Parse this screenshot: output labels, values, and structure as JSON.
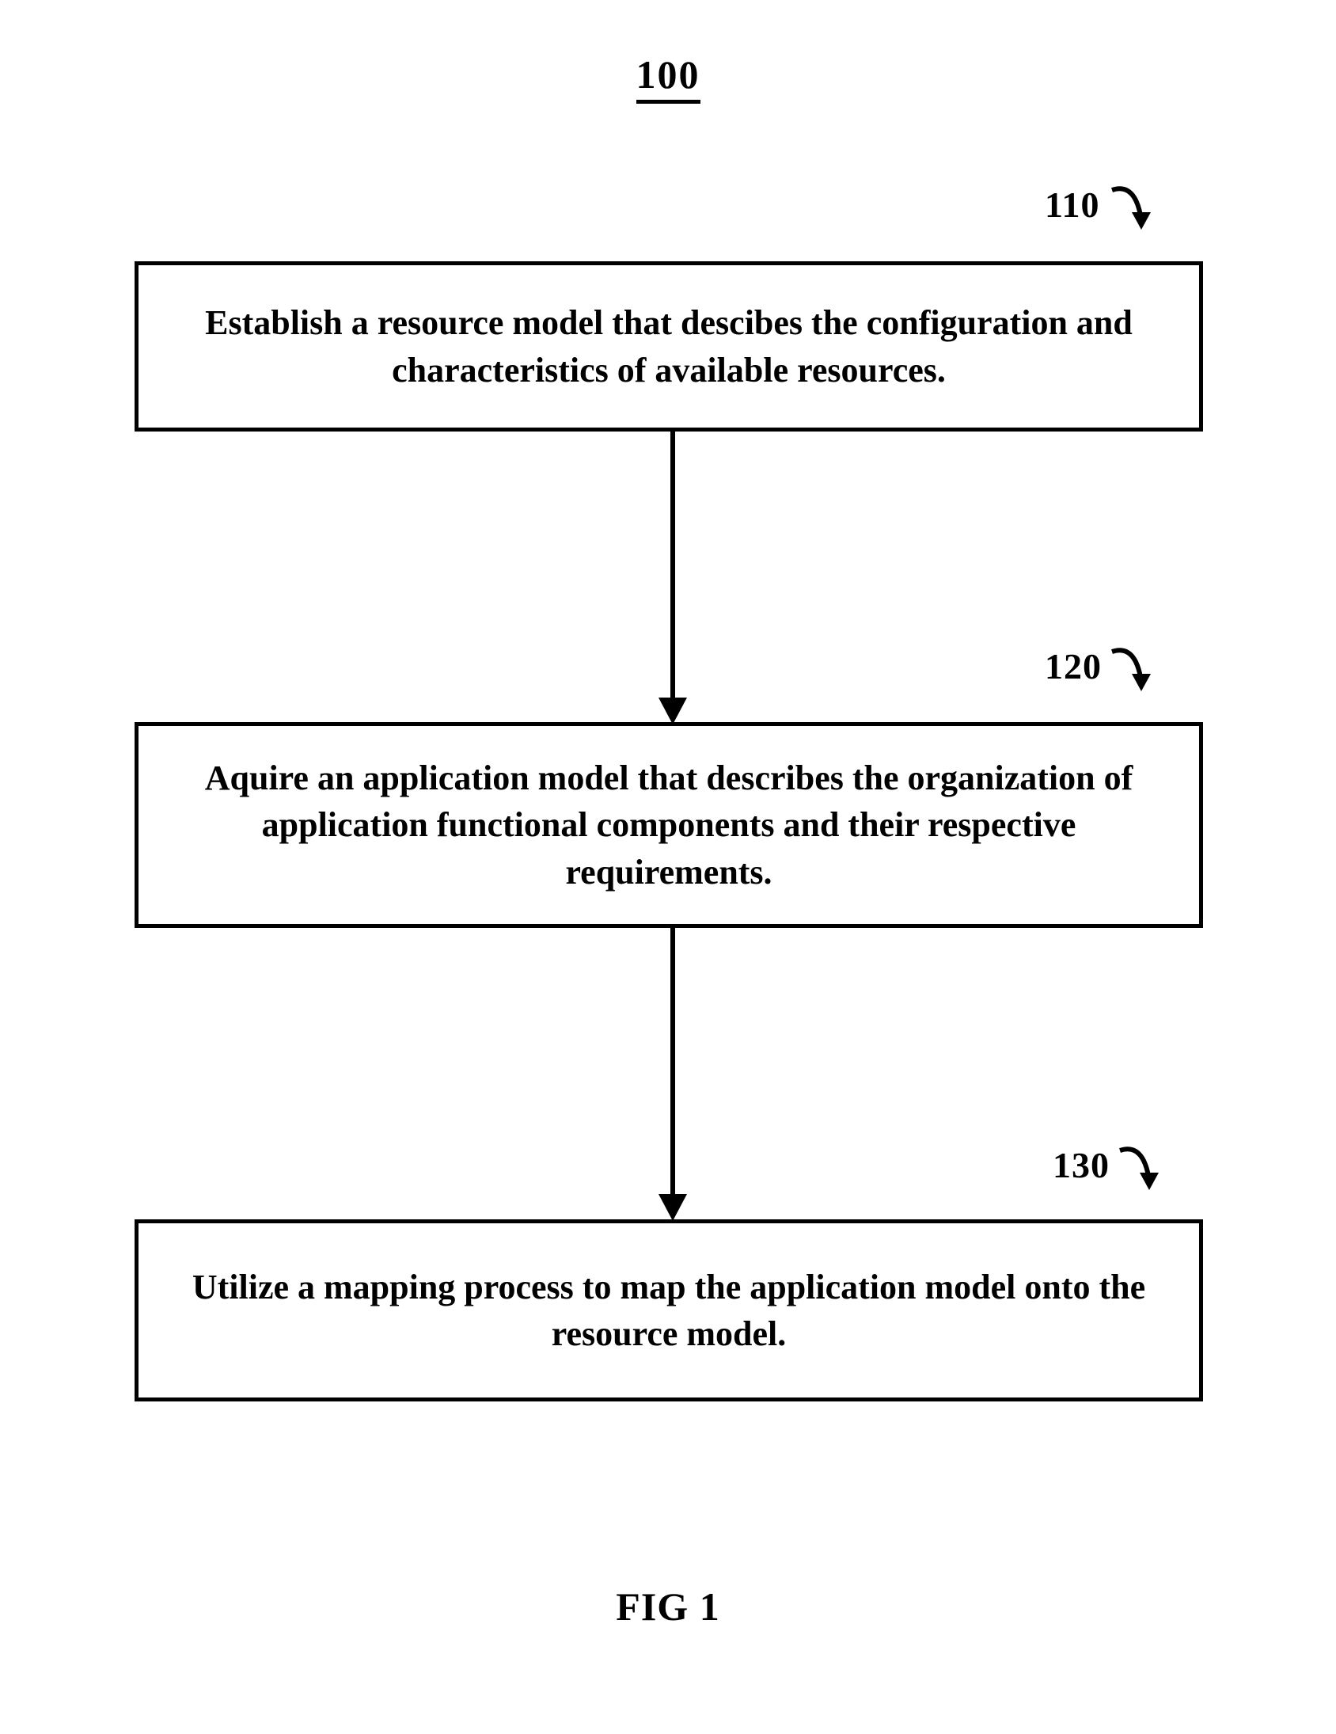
{
  "diagram": {
    "title": "100",
    "caption": "FIG 1",
    "steps": [
      {
        "ref": "110",
        "text": "Establish a resource model that descibes the configuration and characteristics of available resources."
      },
      {
        "ref": "120",
        "text": "Aquire an application model that describes the organization of application functional components and their respective requirements."
      },
      {
        "ref": "130",
        "text": "Utilize a mapping process to map the application model onto the resource model."
      }
    ]
  }
}
